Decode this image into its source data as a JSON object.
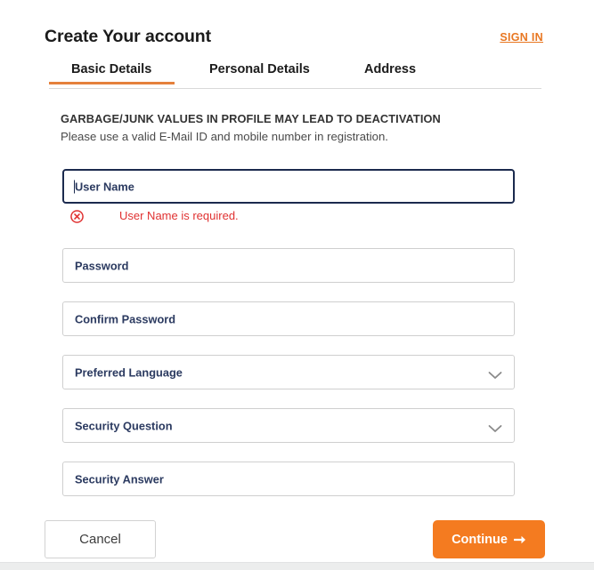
{
  "header": {
    "title": "Create Your account",
    "sign_in_label": "SIGN IN"
  },
  "tabs": [
    {
      "label": "Basic Details",
      "active": true
    },
    {
      "label": "Personal Details",
      "active": false
    },
    {
      "label": "Address",
      "active": false
    }
  ],
  "notice": {
    "heading": "GARBAGE/JUNK VALUES IN PROFILE MAY LEAD TO DEACTIVATION",
    "subtext": "Please use a valid E-Mail ID and mobile number in registration."
  },
  "form": {
    "username": {
      "placeholder": "User Name",
      "value": "",
      "focused": true,
      "error": "User Name is required.",
      "error_icon": "circle-x-icon"
    },
    "password": {
      "placeholder": "Password",
      "value": ""
    },
    "confirm_password": {
      "placeholder": "Confirm Password",
      "value": ""
    },
    "preferred_language": {
      "placeholder": "Preferred Language",
      "value": "",
      "icon": "chevron-down-icon"
    },
    "security_question": {
      "placeholder": "Security Question",
      "value": "",
      "icon": "chevron-down-icon"
    },
    "security_answer": {
      "placeholder": "Security Answer",
      "value": ""
    }
  },
  "actions": {
    "cancel_label": "Cancel",
    "continue_label": "Continue",
    "continue_icon": "arrow-right-icon"
  },
  "colors": {
    "accent_orange": "#f47b20",
    "tab_underline": "#e5813c",
    "focus_border": "#1b2a4e",
    "error_red": "#e03131",
    "placeholder_navy": "#2b3a60"
  }
}
